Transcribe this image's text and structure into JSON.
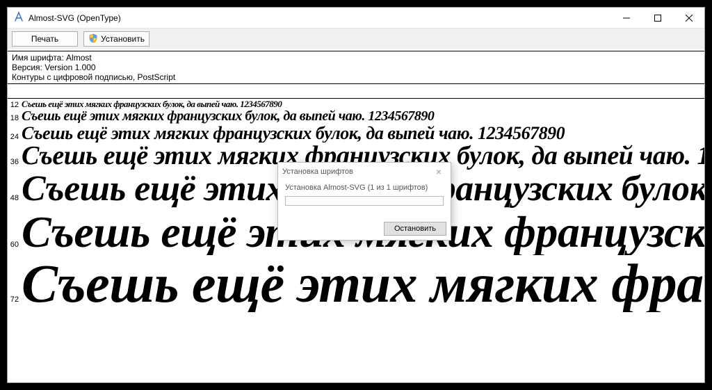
{
  "window": {
    "title": "Almost-SVG (OpenType)"
  },
  "toolbar": {
    "print_label": "Печать",
    "install_label": "Установить"
  },
  "meta": {
    "name": "Имя шрифта: Almost",
    "version": "Версия: Version 1.000",
    "outline": "Контуры с цифровой подписью, PostScript"
  },
  "sample_text": "Съешь ещё этих мягких французских булок, да выпей чаю. 1234567890",
  "sizes": [
    "12",
    "18",
    "24",
    "36",
    "48",
    "60",
    "72"
  ],
  "dialog": {
    "title": "Установка шрифтов",
    "message": "Установка Almost-SVG (1 из 1 шрифтов)",
    "stop_label": "Остановить"
  }
}
